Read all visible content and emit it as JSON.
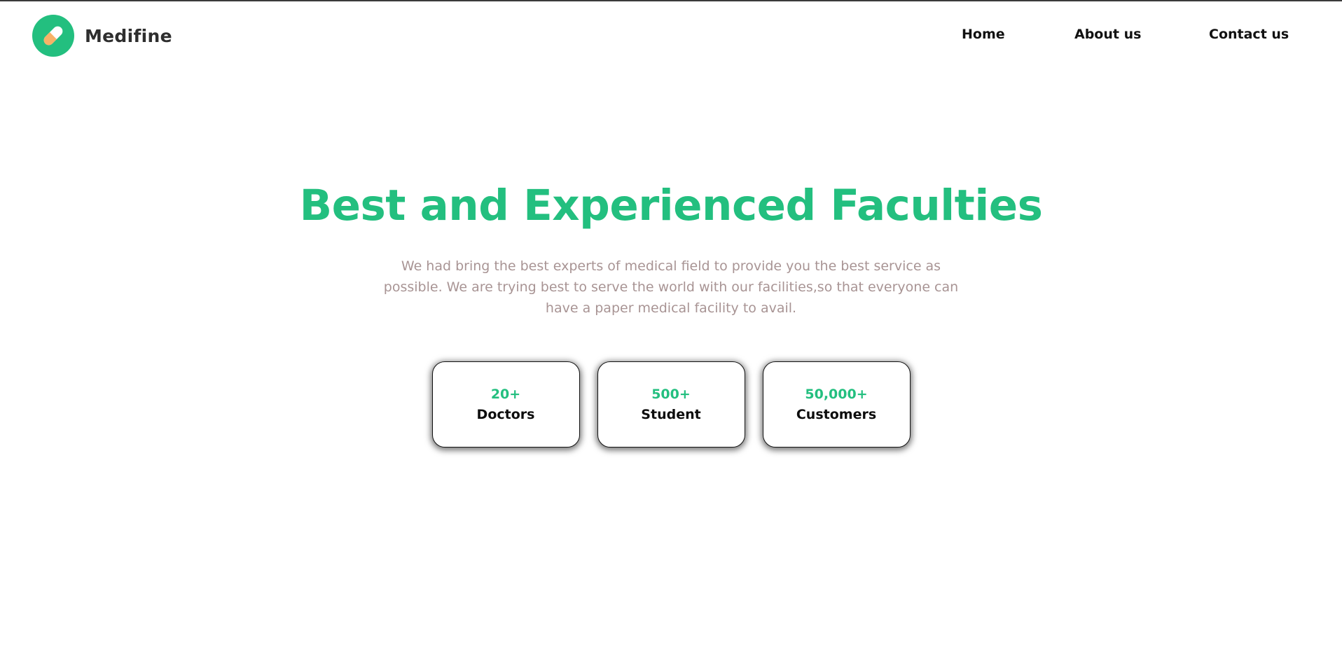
{
  "brand": {
    "name": "Medifine",
    "logo_icon": "pill-icon",
    "accent_color": "#23bf7f"
  },
  "nav": {
    "items": [
      {
        "label": "Home"
      },
      {
        "label": "About us"
      },
      {
        "label": "Contact us"
      }
    ]
  },
  "hero": {
    "title": "Best and Experienced Faculties",
    "description": "We had bring the best experts of medical field to provide you the best service as possible. We are trying best to serve the world with our facilities,so that everyone can have a paper medical facility to avail."
  },
  "stats": [
    {
      "value": "20+",
      "label": "Doctors"
    },
    {
      "value": "500+",
      "label": "Student"
    },
    {
      "value": "50,000+",
      "label": "Customers"
    }
  ],
  "colors": {
    "accent": "#23bf7f",
    "muted_text": "#a89494",
    "capsule_light": "#ffffff",
    "capsule_orange": "#f7b267"
  }
}
